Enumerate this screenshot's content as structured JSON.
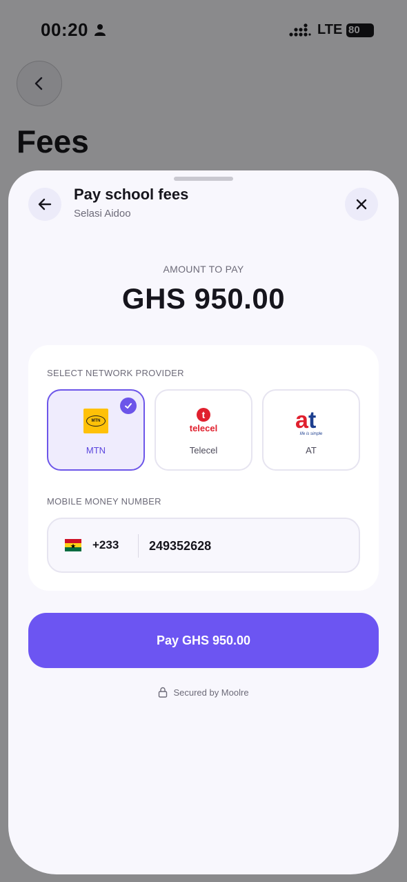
{
  "status_bar": {
    "time": "00:20",
    "network": "LTE",
    "battery": "80"
  },
  "background_page": {
    "title": "Fees"
  },
  "sheet": {
    "title": "Pay school fees",
    "subtitle": "Selasi Aidoo",
    "amount_label": "AMOUNT TO PAY",
    "amount": "GHS 950.00",
    "provider_section_label": "SELECT NETWORK PROVIDER",
    "providers": [
      {
        "name": "MTN",
        "selected": true,
        "logo_text": "MTN"
      },
      {
        "name": "Telecel",
        "selected": false,
        "logo_text": "telecel"
      },
      {
        "name": "AT",
        "selected": false,
        "logo_text": "at",
        "logo_tagline": "life is simple"
      }
    ],
    "mobile_money_label": "MOBILE MONEY NUMBER",
    "country_code": "+233",
    "phone_number": "249352628",
    "pay_button_label": "Pay GHS 950.00",
    "secured_text": "Secured by Moolre"
  },
  "colors": {
    "accent": "#6c55f2",
    "sheet_bg": "#f8f7fd",
    "mtn_yellow": "#ffc107",
    "telecel_red": "#e0202e"
  }
}
